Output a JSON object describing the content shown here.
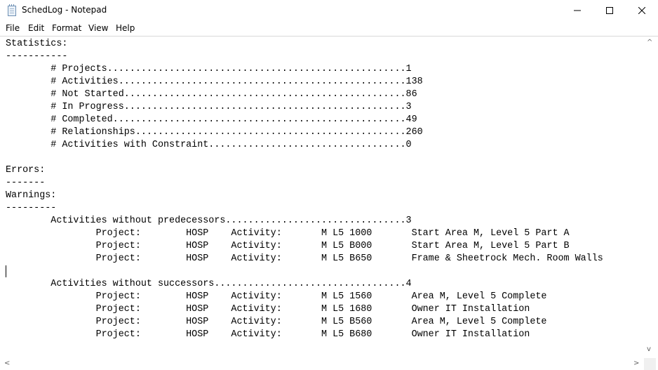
{
  "window": {
    "title": "SchedLog - Notepad"
  },
  "menu": [
    "File",
    "Edit",
    "Format",
    "View",
    "Help"
  ],
  "content_lines": [
    "Statistics:",
    "-----------",
    "        # Projects.....................................................1",
    "        # Activities...................................................138",
    "        # Not Started..................................................86",
    "        # In Progress..................................................3",
    "        # Completed....................................................49",
    "        # Relationships................................................260",
    "        # Activities with Constraint...................................0",
    "",
    "Errors:",
    "-------",
    "Warnings:",
    "---------",
    "        Activities without predecessors................................3",
    "                Project:        HOSP    Activity:       M L5 1000       Start Area M, Level 5 Part A",
    "                Project:        HOSP    Activity:       M L5 B000       Start Area M, Level 5 Part B",
    "                Project:        HOSP    Activity:       M L5 B650       Frame & Sheetrock Mech. Room Walls",
    "",
    "        Activities without successors..................................4",
    "                Project:        HOSP    Activity:       M L5 1560       Area M, Level 5 Complete",
    "                Project:        HOSP    Activity:       M L5 1680       Owner IT Installation",
    "                Project:        HOSP    Activity:       M L5 B560       Area M, Level 5 Complete",
    "                Project:        HOSP    Activity:       M L5 B680       Owner IT Installation"
  ],
  "scroll": {
    "up_arrow": "^",
    "down_arrow": "v",
    "left_arrow": "<",
    "right_arrow": ">"
  }
}
